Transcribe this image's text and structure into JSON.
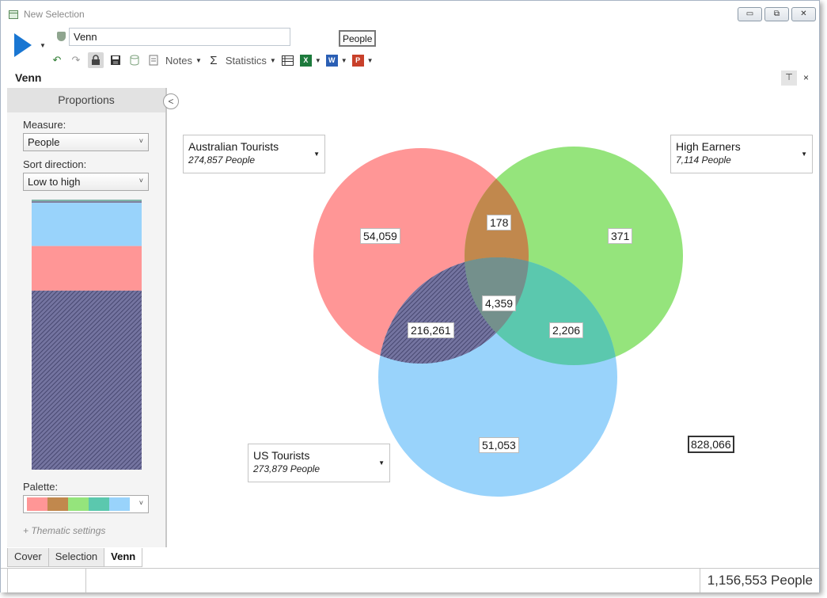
{
  "window": {
    "title": "New Selection",
    "minimize_label": "▭",
    "restore_label": "⧉",
    "close_label": "✕"
  },
  "toolbar": {
    "run_icon": "play-icon",
    "selection_name": "Venn",
    "measure_chip": "People",
    "notes_label": "Notes",
    "statistics_label": "Statistics",
    "sigma": "Σ",
    "undo": "↶",
    "redo": "↷"
  },
  "document": {
    "title": "Venn",
    "pin": "⊤",
    "close": "×"
  },
  "panel": {
    "header": "Proportions",
    "collapse": "<",
    "measure_label": "Measure:",
    "measure_value": "People",
    "sort_label": "Sort direction:",
    "sort_value": "Low to high",
    "palette_label": "Palette:",
    "thematic_link": "+ Thematic settings",
    "proportions": [
      {
        "region": "other",
        "fraction": 0.006,
        "color": "#7fb5a8"
      },
      {
        "region": "other2",
        "fraction": 0.006,
        "color": "#7e7e9e"
      },
      {
        "region": "light-blue",
        "fraction": 0.16,
        "color": "#99d3fb"
      },
      {
        "region": "pink",
        "fraction": 0.165,
        "color": "#ff9696"
      },
      {
        "region": "hatched",
        "fraction": 0.663,
        "color": "#6a6a92"
      }
    ],
    "palette": [
      "#ff9696",
      "#c1884d",
      "#95e47c",
      "#5bc8ae",
      "#99d3fb"
    ]
  },
  "venn": {
    "sets": [
      {
        "name": "Australian Tourists",
        "count": "274,857 People",
        "color": "#ff9696"
      },
      {
        "name": "High Earners",
        "count": "7,114 People",
        "color": "#95e47c"
      },
      {
        "name": "US Tourists",
        "count": "273,879 People",
        "color": "#99d3fb"
      }
    ],
    "regions": {
      "aus_only": "54,059",
      "aus_high": "178",
      "high_only": "371",
      "all_three": "4,359",
      "aus_us": "216,261",
      "high_us": "2,206",
      "us_only": "51,053"
    },
    "outside_total": "828,066"
  },
  "tabs": [
    {
      "label": "Cover"
    },
    {
      "label": "Selection"
    },
    {
      "label": "Venn"
    }
  ],
  "status": {
    "total": "1,156,553 People"
  }
}
